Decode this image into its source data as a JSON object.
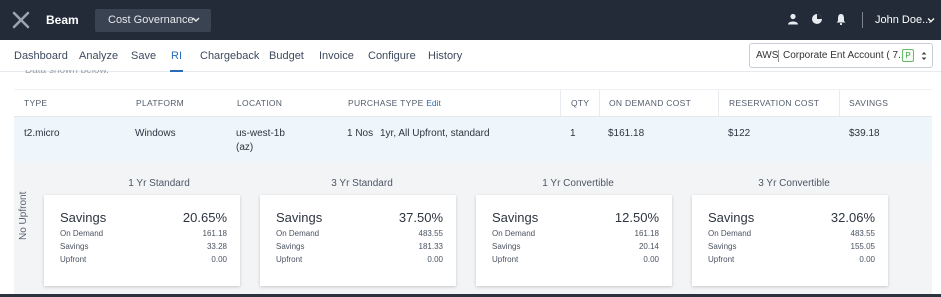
{
  "header": {
    "app_name": "Beam",
    "module": "Cost Governance",
    "user": "John Doe...",
    "icons": [
      "user-icon",
      "pie-chart-icon",
      "bell-icon"
    ]
  },
  "nav": {
    "tabs": [
      "Dashboard",
      "Analyze",
      "Save",
      "RI",
      "Chargeback",
      "Budget",
      "Invoice",
      "Configure",
      "History"
    ],
    "active": "RI",
    "account": {
      "provider": "AWS",
      "name": "Corporate Ent Account ( 7...",
      "badge": "P"
    }
  },
  "partial_text": "Data shown below.",
  "table": {
    "headers": {
      "type": "TYPE",
      "platform": "PLATFORM",
      "location": "LOCATION",
      "purchase_type": "PURCHASE TYPE",
      "edit": "Edit",
      "qty": "QTY",
      "on_demand": "ON DEMAND COST",
      "reservation": "RESERVATION COST",
      "savings": "SAVINGS"
    },
    "row": {
      "type": "t2.micro",
      "platform": "Windows",
      "location": "us-west-1b",
      "location_sub": "(az)",
      "purchase_qty": "1 Nos",
      "purchase_desc": "1yr, All Upfront, standard",
      "qty": "1",
      "on_demand": "$161.18",
      "reservation": "$122",
      "savings": "$39.18"
    }
  },
  "panel": {
    "side_label": "No Upfront",
    "row_labels": [
      "On Demand",
      "Savings",
      "Upfront"
    ],
    "cards": [
      {
        "title": "1 Yr Standard",
        "label": "Savings",
        "percent": "20.65%",
        "on_demand": "161.18",
        "savings": "33.28",
        "upfront": "0.00"
      },
      {
        "title": "3 Yr Standard",
        "label": "Savings",
        "percent": "37.50%",
        "on_demand": "483.55",
        "savings": "181.33",
        "upfront": "0.00"
      },
      {
        "title": "1 Yr Convertible",
        "label": "Savings",
        "percent": "12.50%",
        "on_demand": "161.18",
        "savings": "20.14",
        "upfront": "0.00"
      },
      {
        "title": "3 Yr Convertible",
        "label": "Savings",
        "percent": "32.06%",
        "on_demand": "483.55",
        "savings": "155.05",
        "upfront": "0.00"
      }
    ]
  },
  "colors": {
    "header_bg": "#232b38",
    "accent": "#2a6cb7",
    "row_highlight": "#eef6fb"
  }
}
